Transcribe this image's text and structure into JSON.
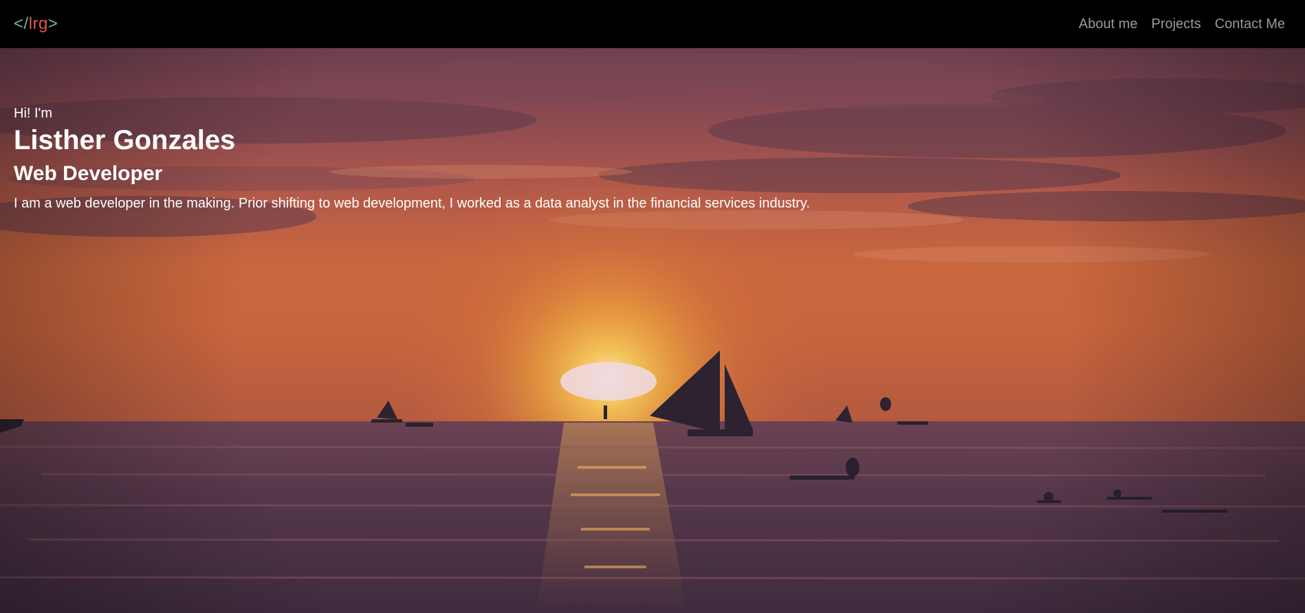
{
  "navbar": {
    "brand": {
      "open": "</",
      "initials": "lrg",
      "close": ">"
    },
    "links": [
      "About me",
      "Projects",
      "Contact Me"
    ]
  },
  "hero": {
    "greeting": "Hi! I'm",
    "name": "Listher Gonzales",
    "role": "Web Developer",
    "description": "I am a web developer in the making. Prior shifting to web development, I worked as a data analyst in the financial services industry.",
    "background_image": "sunset over the sea with sailboats and swimmers"
  },
  "colors": {
    "navbar_bg": "#000000",
    "brand_bracket": "#6fb9a3",
    "brand_initials": "#e2574c",
    "nav_link": "#9a9a9a",
    "hero_text": "#ffffff"
  }
}
